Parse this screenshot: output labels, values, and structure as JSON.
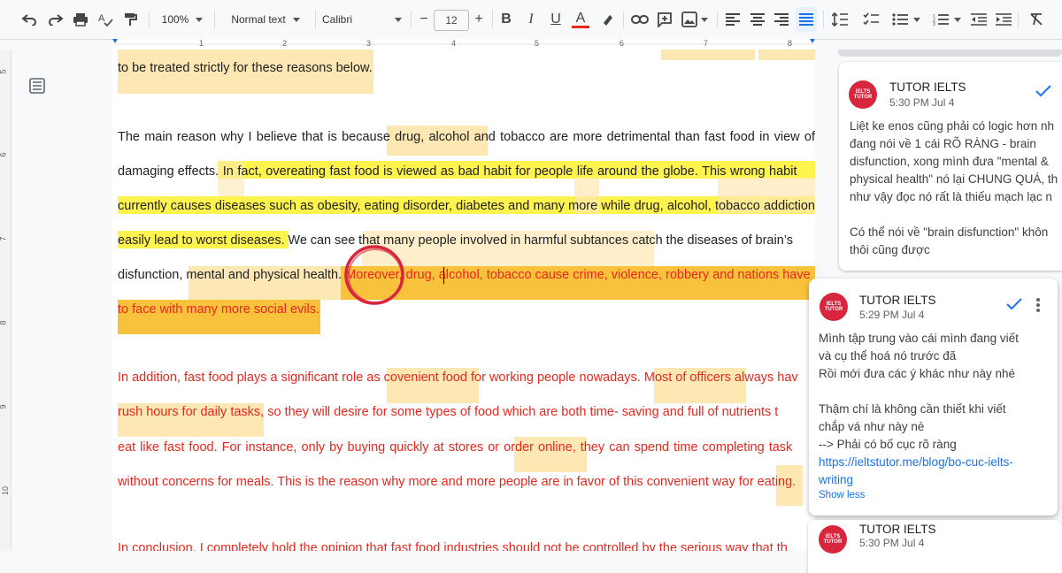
{
  "toolbar": {
    "zoom": "100%",
    "style": "Normal text",
    "font": "Calibri",
    "font_size": "12",
    "minus": "−",
    "plus": "+",
    "bold": "B",
    "italic": "I",
    "underline": "U",
    "text_color": "A"
  },
  "ruler": {
    "numbers": [
      "1",
      "2",
      "3",
      "4",
      "5",
      "6",
      "7",
      "8"
    ]
  },
  "vertical_ruler": {
    "numbers": [
      "5",
      "6",
      "7",
      "8",
      "9",
      "10"
    ]
  },
  "document": {
    "line1": "to be treated strictly for these reasons below.",
    "line2": "The main reason why I believe that is because drug, alcohol and tobacco are more detrimental than fast food in view of",
    "line3a": "damaging effects.",
    "line3b": " In fact, overeating fast food is viewed as bad habit for people life around the globe. This wrong habit",
    "line4": "currently causes diseases such as obesity, eating disorder, diabetes and many more while drug, alcohol, tobacco addiction",
    "line5a": "easily lead to worst diseases.",
    "line5b": " We can see that many people involved in harmful subtances catch the diseases of brain’s",
    "line6a": "disfunction, mental and physical health.",
    "line6b": " Moreover, drug, alcohol, tobacco cause crime, violence, robbery and nations have",
    "line7": "to face with many more social evils.",
    "line8": "In addition, fast food plays a significant role as covenient food for working people nowadays. Most of officers always hav",
    "line9": "rush hours for daily tasks, so they will desire for some types of food which are both time- saving and full of nutrients t",
    "line10": "eat like fast food. For instance, only by buying quickly at stores or order online, they can spend time completing task",
    "line11": "without concerns for meals. This is the reason why more and more people are in favor of this convenient way for eating.",
    "line12": "In conclusion, I completely hold the opinion that fast food industries should not be controlled by the serious way that th"
  },
  "comments": [
    {
      "avatar": "IELTS TUTOR",
      "author": "TUTOR IELTS",
      "time": "5:30 PM Jul 4",
      "lines": [
        "Liệt ke enos cũng phải có logic hơn nh",
        "đang nói về 1 cái RÕ RÀNG - brain",
        "disfunction, xong mình đưa \"mental &",
        "physical health\" nó lại CHUNG QUÁ, th",
        "như vậy đọc nó rất là thiếu mạch lạc n",
        "",
        "Có thể nói về \"brain disfunction\" khôn",
        "thôi cũng được"
      ]
    },
    {
      "avatar": "IELTS TUTOR",
      "author": "TUTOR IELTS",
      "time": "5:29 PM Jul 4",
      "lines": [
        "Mình tập trung vào cái mình đang viết",
        "và cụ thể hoá nó trước đã",
        "Rồi mới đưa các ý khác như này nhé",
        "",
        "Thậm chí là không cần thiết khi viết",
        "chắp vá như này nè",
        "--> Phải có bố cục rõ ràng"
      ],
      "link_line1": "https://ieltstutor.me/blog/bo-cuc-ielts-",
      "link_line2": "writing",
      "show_less": "Show less"
    },
    {
      "avatar": "IELTS TUTOR",
      "author": "TUTOR IELTS",
      "time": "5:30 PM Jul 4"
    }
  ],
  "colors": {
    "accent": "#1a73e8",
    "highlight_light": "#fde8b3",
    "highlight_yellow": "#fff34d",
    "highlight_orange": "#f9c23c",
    "red_text": "#e8271d",
    "circle": "#d7263d"
  }
}
